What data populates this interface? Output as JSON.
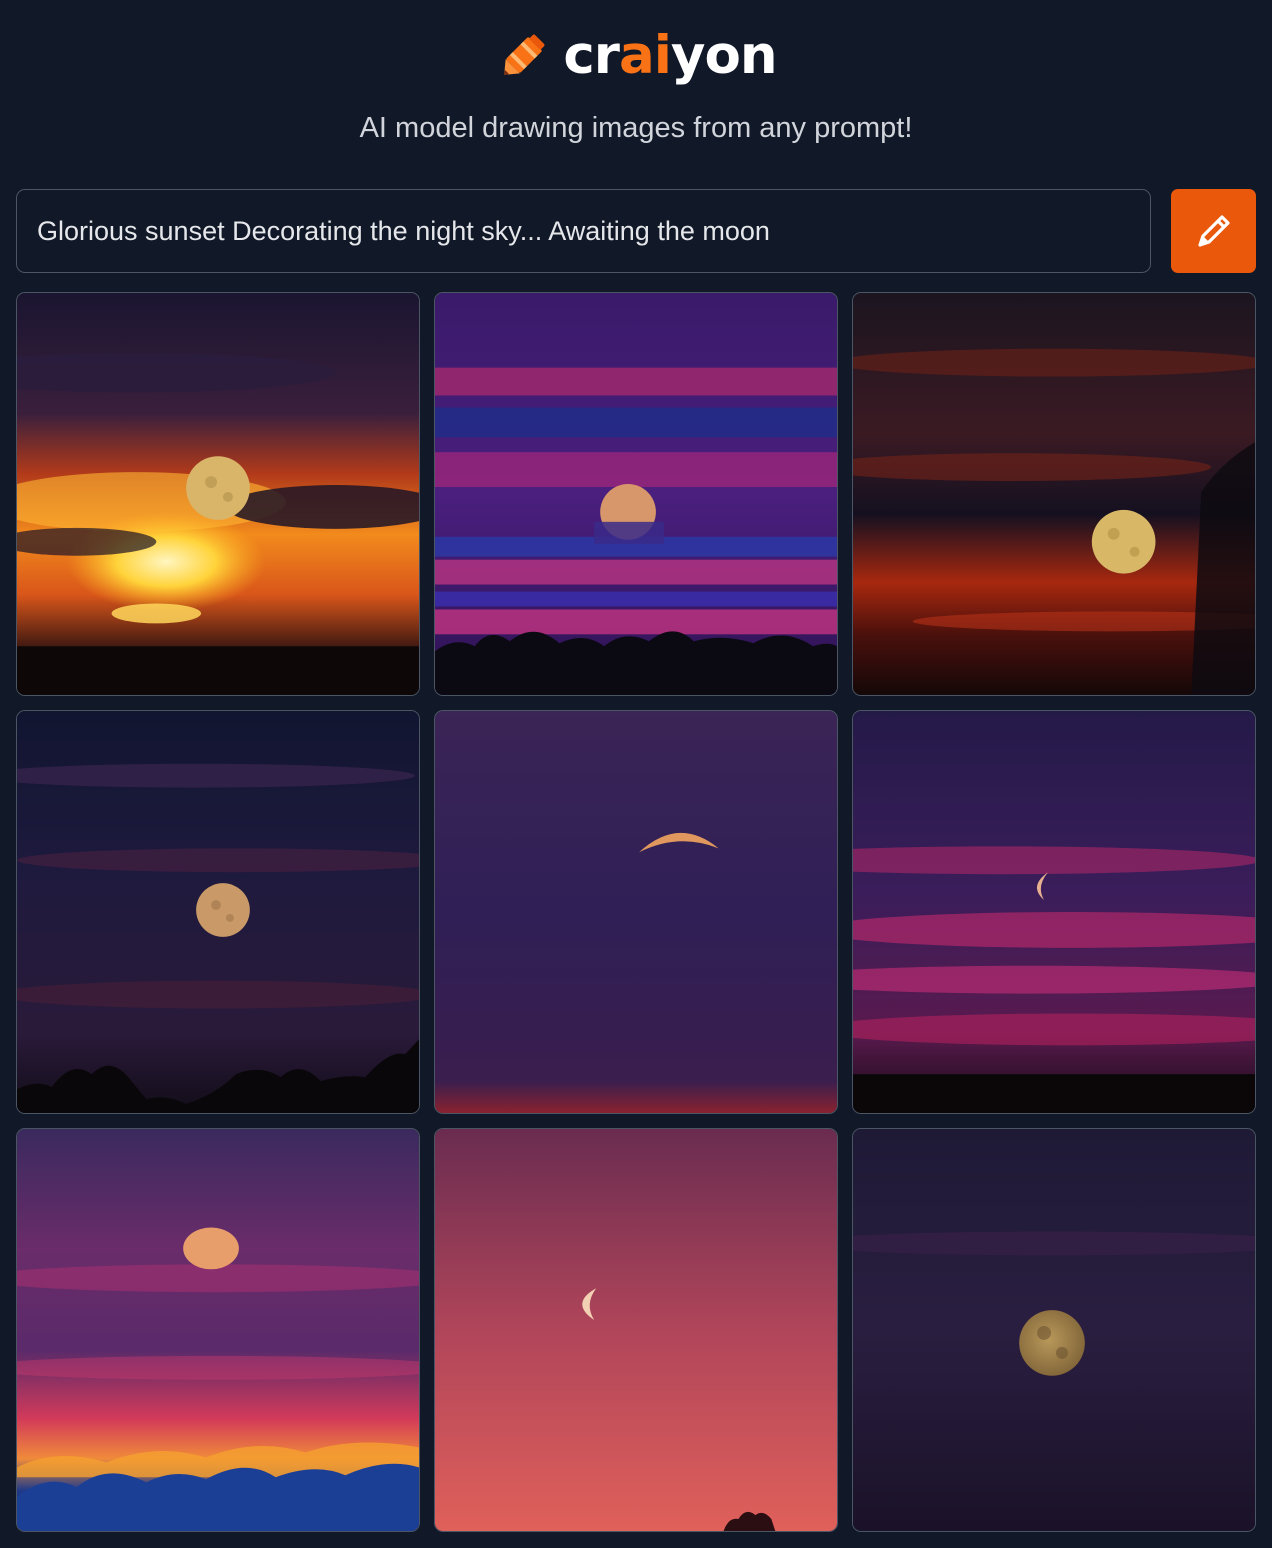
{
  "brand": {
    "name_part1": "cr",
    "name_part2": "ai",
    "name_part3": "yon",
    "accent_color": "#f97316",
    "logo_icon": "crayon-icon"
  },
  "tagline": "AI model drawing images from any prompt!",
  "prompt": {
    "value": "Glorious sunset Decorating the night sky... Awaiting the moon",
    "button_icon": "pencil-icon",
    "button_color": "#ea580c"
  },
  "results": [
    {
      "scene": "fiery orange sunset clouds with full moon"
    },
    {
      "scene": "purple and magenta streaked sky with half moon above trees"
    },
    {
      "scene": "dark red cloudy sky with golden moon"
    },
    {
      "scene": "deep navy sky with full moon above tree silhouettes"
    },
    {
      "scene": "violet sky with crescent moon"
    },
    {
      "scene": "purple and pink streaks with small crescent moon"
    },
    {
      "scene": "purple sky with orange clouds at horizon and moon"
    },
    {
      "scene": "rose gradient sky with thin crescent moon"
    },
    {
      "scene": "dark indigo sky with golden gibbous moon"
    }
  ]
}
